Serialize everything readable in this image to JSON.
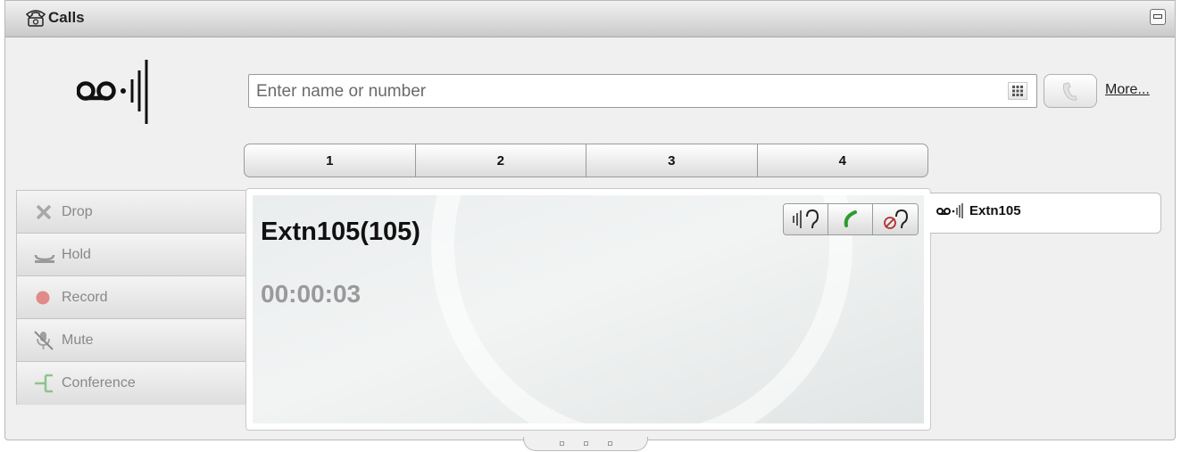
{
  "window": {
    "title": "Calls",
    "title_icon": "phone-icon",
    "minimize_icon": "minimize-icon"
  },
  "logo": {
    "icon": "voicemail-wave-icon"
  },
  "dialer": {
    "placeholder": "Enter name or number",
    "value": "",
    "keypad_icon": "keypad-icon",
    "call_icon": "handset-icon",
    "more_label": "More..."
  },
  "tabs": [
    {
      "label": "1"
    },
    {
      "label": "2"
    },
    {
      "label": "3"
    },
    {
      "label": "4"
    }
  ],
  "actions": [
    {
      "label": "Drop",
      "icon": "drop-x-icon"
    },
    {
      "label": "Hold",
      "icon": "hold-icon"
    },
    {
      "label": "Record",
      "icon": "record-icon"
    },
    {
      "label": "Mute",
      "icon": "mute-icon"
    },
    {
      "label": "Conference",
      "icon": "conference-icon"
    }
  ],
  "active_call": {
    "caller": "Extn105(105)",
    "duration": "00:00:03",
    "controls": [
      {
        "icon": "listen-icon"
      },
      {
        "icon": "answer-icon"
      },
      {
        "icon": "reject-icon"
      }
    ]
  },
  "call_list": [
    {
      "label": "Extn105",
      "icon": "voicemail-wave-icon"
    }
  ],
  "colors": {
    "answer_green": "#2f9a2f",
    "reject_red": "#b03030",
    "record_red": "#e08a8a",
    "conference_green": "#8dc38d"
  }
}
